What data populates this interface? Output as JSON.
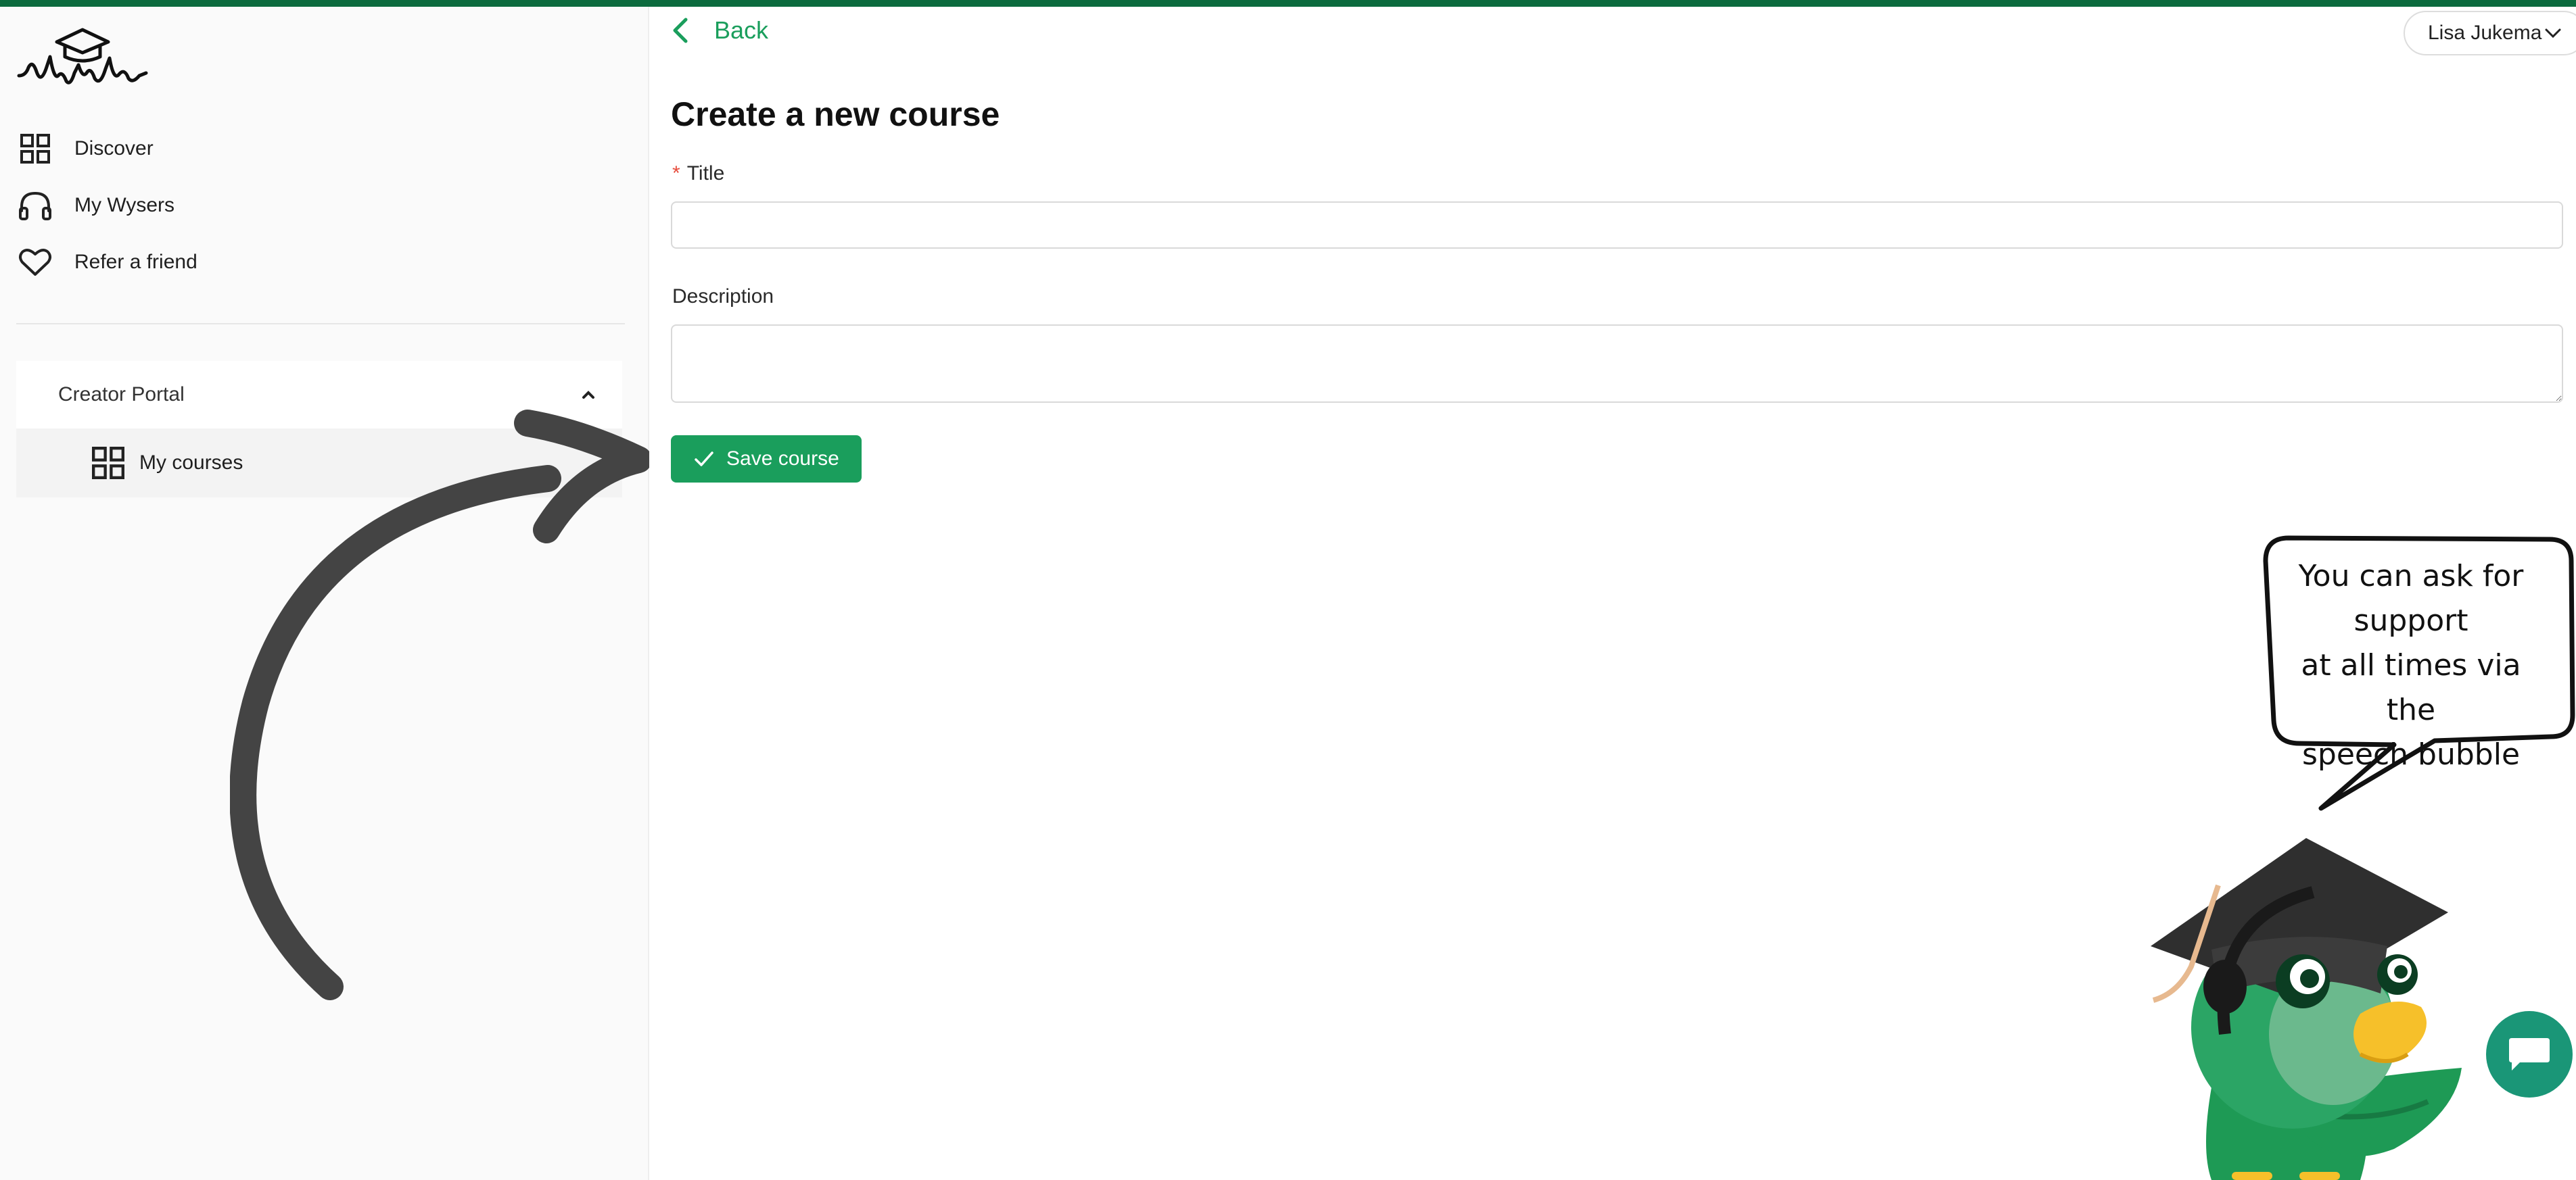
{
  "colors": {
    "brand_green": "#1a9e5c",
    "top_bar": "#0c6b3e",
    "arrow": "#444444"
  },
  "sidebar": {
    "logo": "wysa-graduation-cap-logo",
    "items": [
      {
        "label": "Discover",
        "icon": "grid-icon"
      },
      {
        "label": "My Wysers",
        "icon": "headphones-icon"
      },
      {
        "label": "Refer a friend",
        "icon": "heart-icon"
      }
    ],
    "creator_portal": {
      "label": "Creator Portal",
      "expanded": true
    },
    "submenu": [
      {
        "label": "My courses",
        "icon": "grid-icon"
      }
    ]
  },
  "header": {
    "back_label": "Back",
    "user_name": "Lisa Jukema"
  },
  "form": {
    "title": "Create a new course",
    "title_field": {
      "label": "Title",
      "required_mark": "*",
      "value": ""
    },
    "description_field": {
      "label": "Description",
      "value": ""
    },
    "save_label": "Save course"
  },
  "speech_bubble": {
    "lines": [
      "You can ask for",
      "support",
      "at all times via the",
      "speech bubble"
    ]
  }
}
